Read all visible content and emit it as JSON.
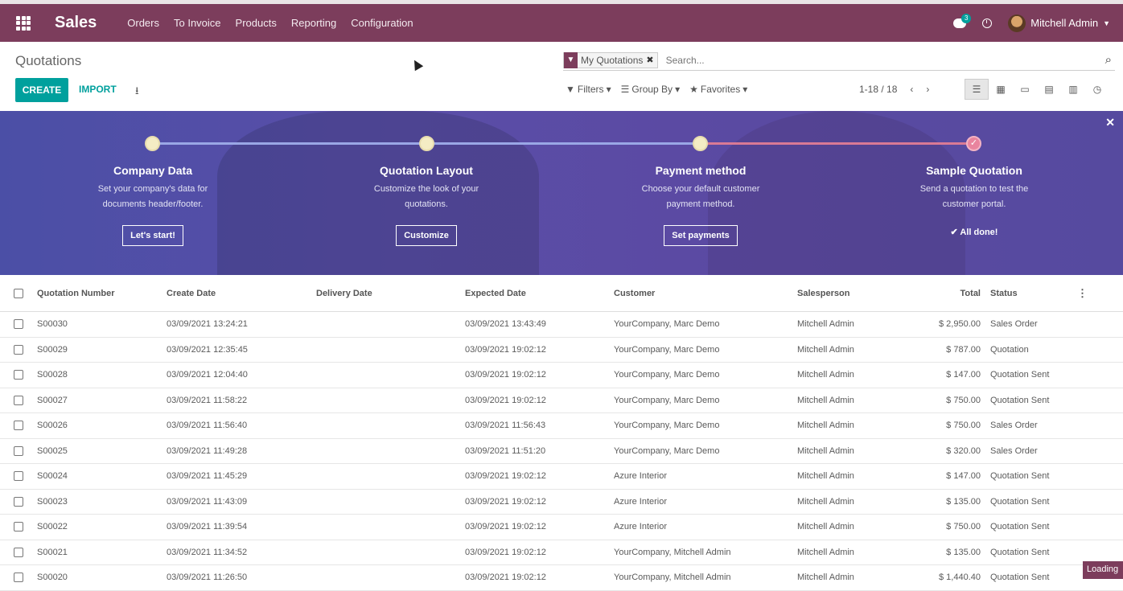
{
  "app": {
    "brand": "Sales"
  },
  "topmenu": [
    "Orders",
    "To Invoice",
    "Products",
    "Reporting",
    "Configuration"
  ],
  "topbar": {
    "chat_count": "3",
    "user_name": "Mitchell Admin"
  },
  "control": {
    "title": "Quotations",
    "create_label": "CREATE",
    "import_label": "IMPORT",
    "facet_label": "My Quotations",
    "search_placeholder": "Search...",
    "filters_label": "Filters",
    "groupby_label": "Group By",
    "favorites_label": "Favorites",
    "pager": "1-18 / 18"
  },
  "banner": {
    "steps": [
      {
        "title": "Company Data",
        "desc": "Set your company's data for documents header/footer.",
        "button": "Let's start!"
      },
      {
        "title": "Quotation Layout",
        "desc": "Customize the look of your quotations.",
        "button": "Customize"
      },
      {
        "title": "Payment method",
        "desc": "Choose your default customer payment method.",
        "button": "Set payments"
      },
      {
        "title": "Sample Quotation",
        "desc": "Send a quotation to test the customer portal.",
        "done": "All done!"
      }
    ]
  },
  "table": {
    "headers": [
      "Quotation Number",
      "Create Date",
      "Delivery Date",
      "Expected Date",
      "Customer",
      "Salesperson",
      "Total",
      "Status"
    ],
    "rows": [
      [
        "S00030",
        "03/09/2021 13:24:21",
        "",
        "03/09/2021 13:43:49",
        "YourCompany, Marc Demo",
        "Mitchell Admin",
        "$ 2,950.00",
        "Sales Order"
      ],
      [
        "S00029",
        "03/09/2021 12:35:45",
        "",
        "03/09/2021 19:02:12",
        "YourCompany, Marc Demo",
        "Mitchell Admin",
        "$ 787.00",
        "Quotation"
      ],
      [
        "S00028",
        "03/09/2021 12:04:40",
        "",
        "03/09/2021 19:02:12",
        "YourCompany, Marc Demo",
        "Mitchell Admin",
        "$ 147.00",
        "Quotation Sent"
      ],
      [
        "S00027",
        "03/09/2021 11:58:22",
        "",
        "03/09/2021 19:02:12",
        "YourCompany, Marc Demo",
        "Mitchell Admin",
        "$ 750.00",
        "Quotation Sent"
      ],
      [
        "S00026",
        "03/09/2021 11:56:40",
        "",
        "03/09/2021 11:56:43",
        "YourCompany, Marc Demo",
        "Mitchell Admin",
        "$ 750.00",
        "Sales Order"
      ],
      [
        "S00025",
        "03/09/2021 11:49:28",
        "",
        "03/09/2021 11:51:20",
        "YourCompany, Marc Demo",
        "Mitchell Admin",
        "$ 320.00",
        "Sales Order"
      ],
      [
        "S00024",
        "03/09/2021 11:45:29",
        "",
        "03/09/2021 19:02:12",
        "Azure Interior",
        "Mitchell Admin",
        "$ 147.00",
        "Quotation Sent"
      ],
      [
        "S00023",
        "03/09/2021 11:43:09",
        "",
        "03/09/2021 19:02:12",
        "Azure Interior",
        "Mitchell Admin",
        "$ 135.00",
        "Quotation Sent"
      ],
      [
        "S00022",
        "03/09/2021 11:39:54",
        "",
        "03/09/2021 19:02:12",
        "Azure Interior",
        "Mitchell Admin",
        "$ 750.00",
        "Quotation Sent"
      ],
      [
        "S00021",
        "03/09/2021 11:34:52",
        "",
        "03/09/2021 19:02:12",
        "YourCompany, Mitchell Admin",
        "Mitchell Admin",
        "$ 135.00",
        "Quotation Sent"
      ],
      [
        "S00020",
        "03/09/2021 11:26:50",
        "",
        "03/09/2021 19:02:12",
        "YourCompany, Mitchell Admin",
        "Mitchell Admin",
        "$ 1,440.40",
        "Quotation Sent"
      ]
    ]
  },
  "status": {
    "loading": "Loading"
  }
}
